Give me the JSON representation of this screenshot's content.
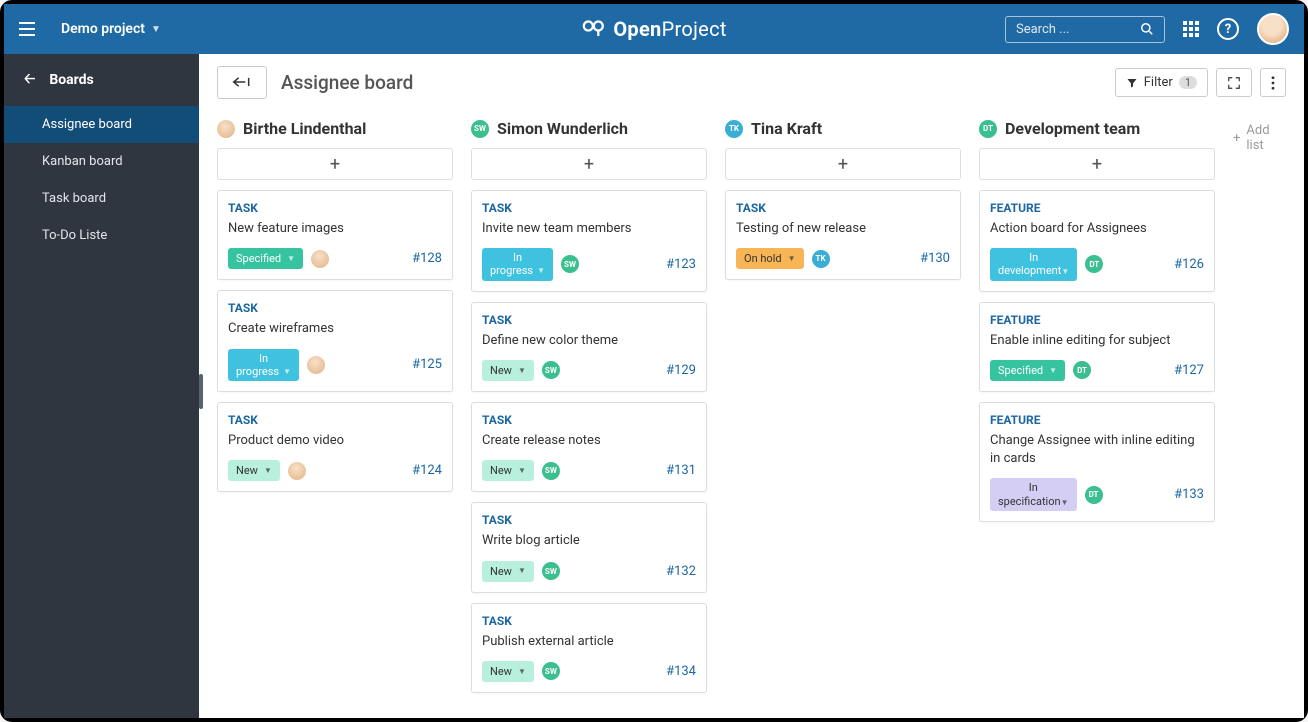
{
  "header": {
    "project": "Demo project",
    "logo": "OpenProject",
    "search_placeholder": "Search ..."
  },
  "sidebar": {
    "title": "Boards",
    "items": [
      {
        "label": "Assignee board",
        "active": true
      },
      {
        "label": "Kanban board",
        "active": false
      },
      {
        "label": "Task board",
        "active": false
      },
      {
        "label": "To-Do Liste",
        "active": false
      }
    ]
  },
  "toolbar": {
    "page_title": "Assignee board",
    "filter_label": "Filter",
    "filter_count": "1"
  },
  "add_list_label": "Add list",
  "columns": [
    {
      "title": "Birthe Lindenthal",
      "avatar": {
        "type": "photo"
      },
      "cards": [
        {
          "type": "TASK",
          "title": "New feature images",
          "status": {
            "text": "Specified",
            "class": "pill-specified"
          },
          "assignee": {
            "type": "photo"
          },
          "id": "#128"
        },
        {
          "type": "TASK",
          "title": "Create wireframes",
          "status": {
            "text": "In progress",
            "class": "pill-progress",
            "multiline": true
          },
          "assignee": {
            "type": "photo"
          },
          "id": "#125"
        },
        {
          "type": "TASK",
          "title": "Product demo video",
          "status": {
            "text": "New",
            "class": "pill-new"
          },
          "assignee": {
            "type": "photo"
          },
          "id": "#124"
        }
      ]
    },
    {
      "title": "Simon Wunderlich",
      "avatar": {
        "type": "initials",
        "text": "SW",
        "color": "#3bbf8f"
      },
      "cards": [
        {
          "type": "TASK",
          "title": "Invite new team members",
          "status": {
            "text": "In progress",
            "class": "pill-progress",
            "multiline": true
          },
          "assignee": {
            "type": "initials",
            "text": "SW",
            "color": "#3bbf8f"
          },
          "id": "#123"
        },
        {
          "type": "TASK",
          "title": "Define new color theme",
          "status": {
            "text": "New",
            "class": "pill-new"
          },
          "assignee": {
            "type": "initials",
            "text": "SW",
            "color": "#3bbf8f"
          },
          "id": "#129"
        },
        {
          "type": "TASK",
          "title": "Create release notes",
          "status": {
            "text": "New",
            "class": "pill-new"
          },
          "assignee": {
            "type": "initials",
            "text": "SW",
            "color": "#3bbf8f"
          },
          "id": "#131"
        },
        {
          "type": "TASK",
          "title": "Write blog article",
          "status": {
            "text": "New",
            "class": "pill-new"
          },
          "assignee": {
            "type": "initials",
            "text": "SW",
            "color": "#3bbf8f"
          },
          "id": "#132"
        },
        {
          "type": "TASK",
          "title": "Publish external article",
          "status": {
            "text": "New",
            "class": "pill-new"
          },
          "assignee": {
            "type": "initials",
            "text": "SW",
            "color": "#3bbf8f"
          },
          "id": "#134"
        }
      ]
    },
    {
      "title": "Tina Kraft",
      "avatar": {
        "type": "initials",
        "text": "TK",
        "color": "#3baed6"
      },
      "cards": [
        {
          "type": "TASK",
          "title": "Testing of new release",
          "status": {
            "text": "On hold",
            "class": "pill-hold"
          },
          "assignee": {
            "type": "initials",
            "text": "TK",
            "color": "#3baed6"
          },
          "id": "#130"
        }
      ]
    },
    {
      "title": "Development team",
      "avatar": {
        "type": "initials",
        "text": "DT",
        "color": "#3bbf8f"
      },
      "cards": [
        {
          "type": "FEATURE",
          "title": "Action board for Assignees",
          "status": {
            "text": "In development",
            "class": "pill-dev",
            "multiline": true
          },
          "assignee": {
            "type": "initials",
            "text": "DT",
            "color": "#3bbf8f"
          },
          "id": "#126"
        },
        {
          "type": "FEATURE",
          "title": "Enable inline editing for subject",
          "status": {
            "text": "Specified",
            "class": "pill-specified"
          },
          "assignee": {
            "type": "initials",
            "text": "DT",
            "color": "#3bbf8f"
          },
          "id": "#127"
        },
        {
          "type": "FEATURE",
          "title": "Change Assignee with inline editing in cards",
          "status": {
            "text": "In specification",
            "class": "pill-spec",
            "multiline": true
          },
          "assignee": {
            "type": "initials",
            "text": "DT",
            "color": "#3bbf8f"
          },
          "id": "#133"
        }
      ]
    }
  ]
}
